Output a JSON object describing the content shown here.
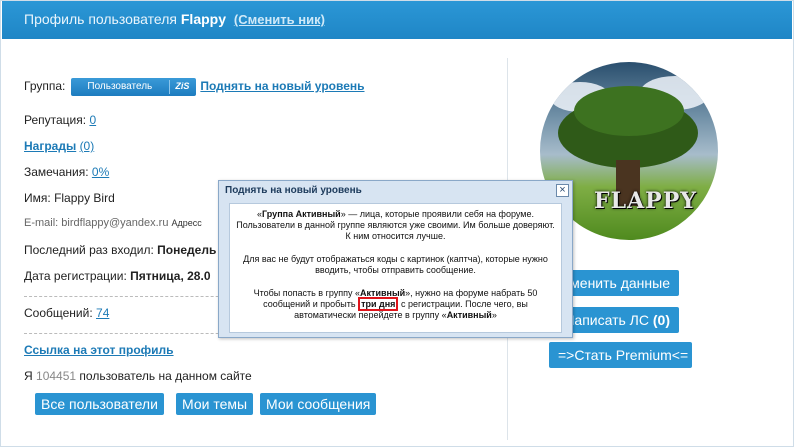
{
  "header": {
    "title_prefix": "Профиль пользователя",
    "username": "Flappy",
    "change_nick": "(Сменить ник)"
  },
  "profile": {
    "group_label": "Группа:",
    "group_name": "Пользователь",
    "group_code": "ZiS",
    "level_up_link": "Поднять на новый уровень",
    "reputation_label": "Репутация:",
    "reputation_value": "0",
    "awards_label": "Награды",
    "awards_value": "(0)",
    "warnings_label": "Замечания:",
    "warnings_value": "0%",
    "name_label": "Имя:",
    "name_value": "Flappy Bird",
    "email_label": "E-mail:",
    "email_value": "birdflappy@yandex.ru",
    "email_note": "Адресс",
    "last_visit_label": "Последний раз входил:",
    "last_visit_value": "Понедель",
    "reg_date_label": "Дата регистрации:",
    "reg_date_value": "Пятница, 28.0",
    "messages_label": "Сообщений:",
    "messages_value": "74",
    "profile_link": "Ссылка на этот профиль",
    "user_rank_prefix": "Я",
    "user_rank_number": "104451",
    "user_rank_suffix": "пользователь на данном сайте"
  },
  "avatar": {
    "logo_text": "FLAPPY"
  },
  "right_buttons": {
    "edit": "Изменить данные",
    "send_pm_prefix": "Написать ЛС",
    "send_pm_count": "(0)",
    "premium": "=>Стать Premium<="
  },
  "bottom_buttons": {
    "all_users": "Все пользователи",
    "my_topics": "Мои темы",
    "my_messages": "Мои сообщения"
  },
  "popup": {
    "title": "Поднять на новый уровень",
    "close": "×",
    "p1_open": "«",
    "p1_group": "Группа Активный",
    "p1_rest": "» — лица, которые проявили себя на форуме. Пользователи в данной группе являются уже своими. Им больше доверяют. К ним относится лучше.",
    "p2": "Для вас не будут отображаться коды с картинок (каптча), которые нужно вводить, чтобы отправить сообщение.",
    "p3_a": "Чтобы попасть в группу «",
    "p3_group": "Активный",
    "p3_b": "», нужно на форуме набрать 50 сообщений и пробыть",
    "p3_hl": "три дня",
    "p3_c": "с регистрации. После чего, вы автоматически перейдете в группу «",
    "p3_group2": "Активный",
    "p3_d": "»"
  },
  "colors": {
    "accent": "#2a94d2",
    "header": "#1f86c6",
    "link": "#1c7ab6",
    "highlight_border": "#e0141b"
  }
}
